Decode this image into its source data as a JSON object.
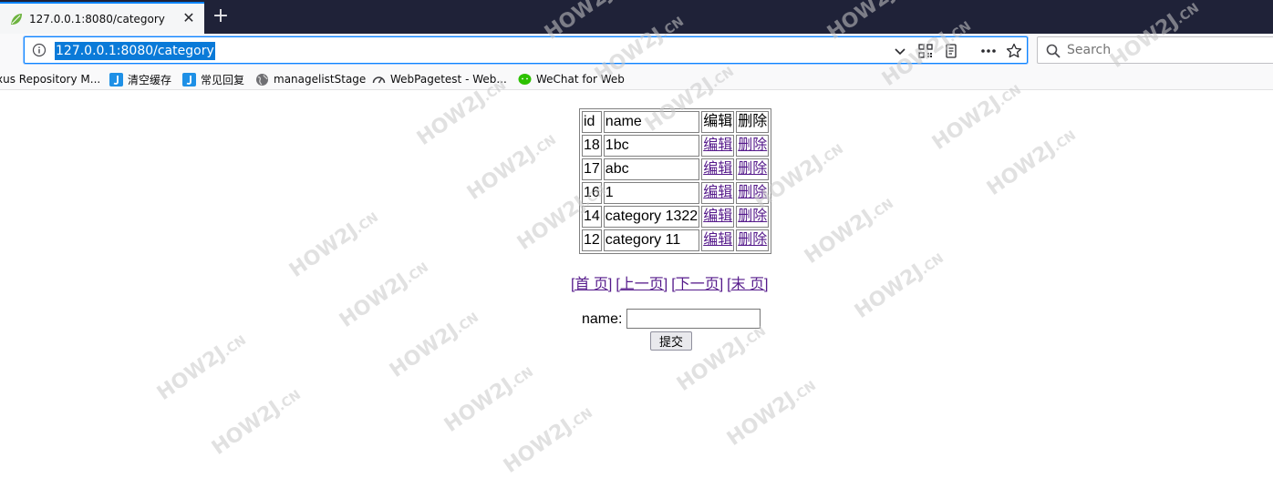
{
  "browser": {
    "tab": {
      "title": "127.0.0.1:8080/category",
      "close": "✕"
    },
    "newtab": "+",
    "url": "127.0.0.1:8080/category",
    "search_placeholder": "Search"
  },
  "bookmarks": [
    {
      "label": "xus Repository M...",
      "icon": "nexus-icon"
    },
    {
      "label": "清空缓存",
      "icon": "j-bookmark-icon"
    },
    {
      "label": "常见回复",
      "icon": "j-bookmark-icon"
    },
    {
      "label": "managelistStage",
      "icon": "globe-icon"
    },
    {
      "label": "WebPagetest - Web...",
      "icon": "speedometer-icon"
    },
    {
      "label": "WeChat for Web",
      "icon": "wechat-icon"
    }
  ],
  "table": {
    "headers": [
      "id",
      "name",
      "编辑",
      "删除"
    ],
    "rows": [
      {
        "id": "18",
        "name": "1bc",
        "edit": "编辑",
        "delete": "删除"
      },
      {
        "id": "17",
        "name": "abc",
        "edit": "编辑",
        "delete": "删除"
      },
      {
        "id": "16",
        "name": "1",
        "edit": "编辑",
        "delete": "删除"
      },
      {
        "id": "14",
        "name": "category 1322",
        "edit": "编辑",
        "delete": "删除"
      },
      {
        "id": "12",
        "name": "category 11",
        "edit": "编辑",
        "delete": "删除"
      }
    ]
  },
  "pager": {
    "first": "[首 页]",
    "prev": "[上一页]",
    "next": "[下一页]",
    "last": "[末 页]"
  },
  "form": {
    "label": "name:",
    "value": "",
    "submit": "提交"
  },
  "watermark": {
    "main": "HOW2J",
    "suffix": ".CN"
  },
  "colors": {
    "accent": "#0a84ff",
    "visited_link": "#551a8b",
    "tabstrip": "#1f2238"
  }
}
